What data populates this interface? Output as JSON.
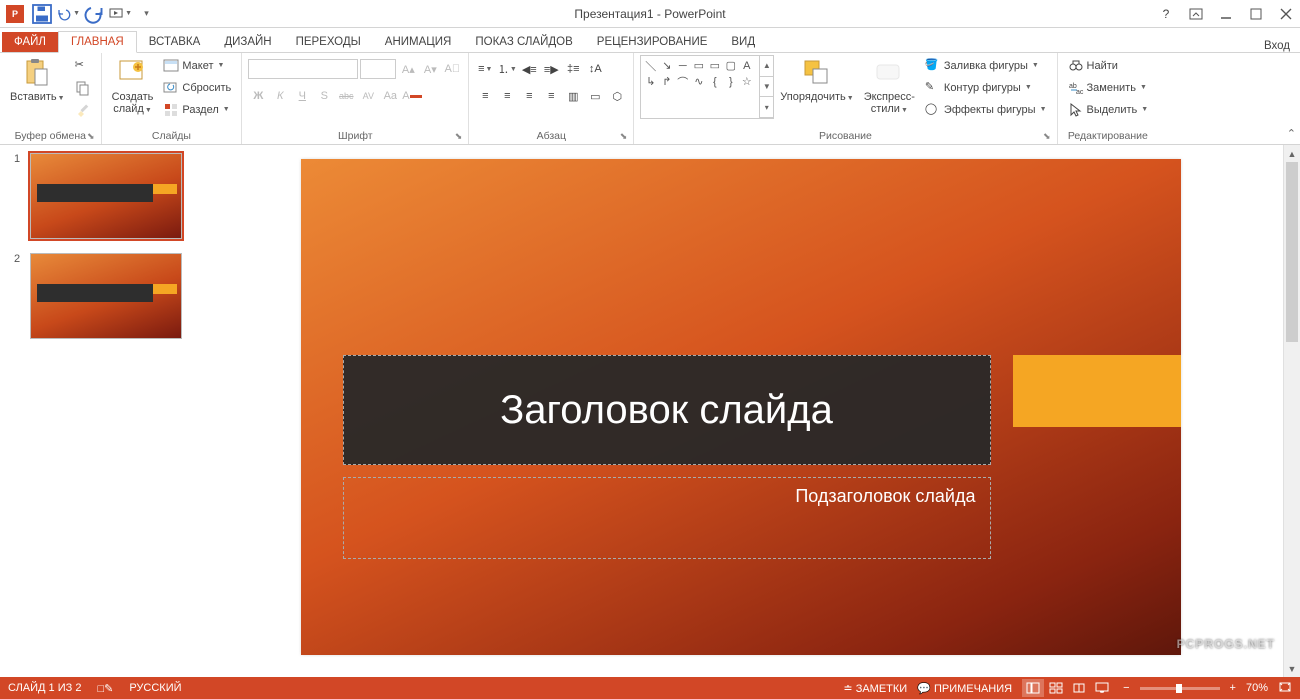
{
  "title": "Презентация1 - PowerPoint",
  "login": "Вход",
  "tabs": {
    "file": "ФАЙЛ",
    "home": "ГЛАВНАЯ",
    "insert": "ВСТАВКА",
    "design": "ДИЗАЙН",
    "transitions": "ПЕРЕХОДЫ",
    "animations": "АНИМАЦИЯ",
    "slideshow": "ПОКАЗ СЛАЙДОВ",
    "review": "РЕЦЕНЗИРОВАНИЕ",
    "view": "ВИД"
  },
  "ribbon": {
    "clipboard": {
      "paste": "Вставить",
      "label": "Буфер обмена"
    },
    "slides": {
      "newslide": "Создать\nслайд",
      "layout": "Макет",
      "reset": "Сбросить",
      "section": "Раздел",
      "label": "Слайды"
    },
    "font": {
      "label": "Шрифт",
      "bold": "Ж",
      "italic": "К",
      "underline": "Ч",
      "strike": "abc",
      "shadow": "S",
      "charspace": "AV",
      "case": "Aa",
      "color": "A"
    },
    "para": {
      "label": "Абзац"
    },
    "draw": {
      "arrange": "Упорядочить",
      "quickstyles": "Экспресс-\nстили",
      "fill": "Заливка фигуры",
      "outline": "Контур фигуры",
      "effects": "Эффекты фигуры",
      "label": "Рисование"
    },
    "edit": {
      "find": "Найти",
      "replace": "Заменить",
      "select": "Выделить",
      "label": "Редактирование"
    }
  },
  "thumbs": {
    "n1": "1",
    "n2": "2"
  },
  "slide": {
    "title": "Заголовок слайда",
    "subtitle": "Подзаголовок слайда"
  },
  "status": {
    "slideinfo": "СЛАЙД 1 ИЗ 2",
    "lang": "РУССКИЙ",
    "notes": "ЗАМЕТКИ",
    "comments": "ПРИМЕЧАНИЯ",
    "zoom": "70%"
  },
  "watermark": "PCPROGS.NET"
}
